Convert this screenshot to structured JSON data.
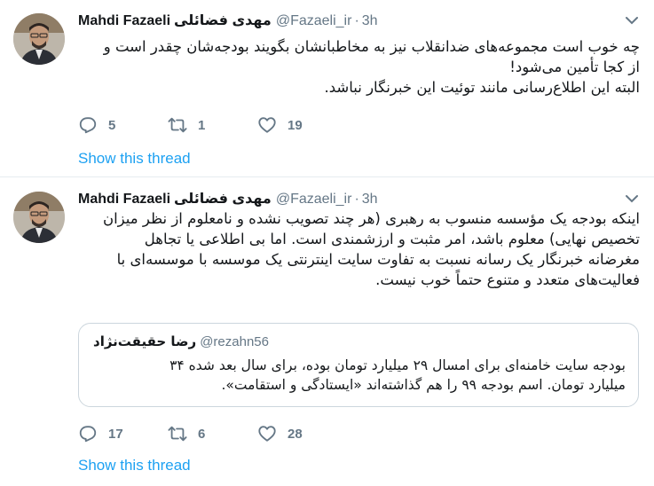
{
  "tweets": [
    {
      "author_name": "Mahdi Fazaeli",
      "author_name_fa": "مهدی فضائلی",
      "handle": "@Fazaeli_ir",
      "separator": "·",
      "time": "3h",
      "text_lines": [
        "چه خوب است مجموعه‌های ضدانقلاب نیز به مخاطبانشان بگویند بودجه‌شان چقدر است و",
        "از کجا تأمین می‌شود!",
        "البته این اطلاع‌رسانی مانند توئیت این خبرنگار نباشد."
      ],
      "replies": "5",
      "retweets": "1",
      "likes": "19",
      "show_thread": "Show this thread"
    },
    {
      "author_name": "Mahdi Fazaeli",
      "author_name_fa": "مهدی فضائلی",
      "handle": "@Fazaeli_ir",
      "separator": "·",
      "time": "3h",
      "text_lines": [
        "اینکه بودجه یک مؤسسه منسوب به رهبری (هر چند تصویب نشده و نامعلوم از نظر میزان",
        "تخصیص نهایی) معلوم باشد، امر مثبت و ارزشمندی است. اما بی اطلاعی یا تجاهل",
        "مغرضانه خبرنگار یک رسانه نسبت به تفاوت سایت اینترنتی یک موسسه با موسسه‌ای با",
        "فعالیت‌های متعدد و متنوع حتماً خوب نیست."
      ],
      "quote": {
        "name": "رضا حقیقت‌نژاد",
        "handle": "@rezahn56",
        "text_lines": [
          "بودجه سایت خامنه‌ای برای امسال ۲۹ میلیارد تومان بوده، برای سال بعد شده ۳۴",
          "میلیارد تومان. اسم بودجه ۹۹ را هم گذاشته‌اند «ایستادگی و استقامت»."
        ]
      },
      "replies": "17",
      "retweets": "6",
      "likes": "28",
      "show_thread": "Show this thread"
    }
  ],
  "icons": {
    "avatar": "profile-photo",
    "caret": "chevron-down-icon",
    "reply": "reply-icon",
    "retweet": "retweet-icon",
    "like": "heart-icon"
  },
  "colors": {
    "link": "#1da1f2",
    "muted": "#657786",
    "text": "#14171a",
    "divider": "#e6ecf0"
  }
}
